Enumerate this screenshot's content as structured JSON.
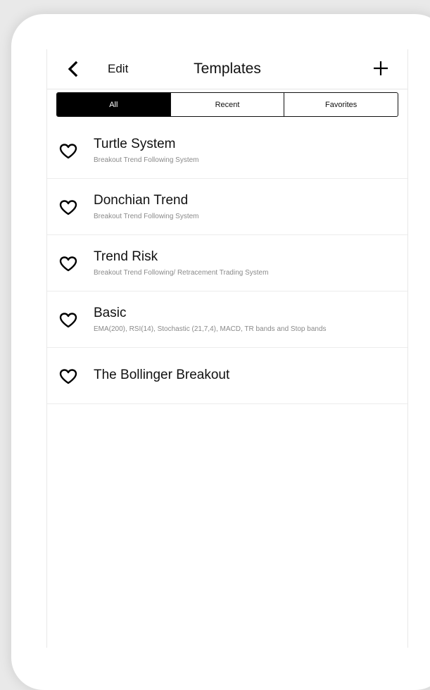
{
  "navbar": {
    "back_icon": "chevron-left-icon",
    "edit_label": "Edit",
    "title": "Templates",
    "add_icon": "plus-icon"
  },
  "tabs": [
    {
      "label": "All",
      "active": true
    },
    {
      "label": "Recent",
      "active": false
    },
    {
      "label": "Favorites",
      "active": false
    }
  ],
  "templates": [
    {
      "title": "Turtle System",
      "subtitle": "Breakout Trend Following System",
      "favorite_icon": "heart-outline-icon"
    },
    {
      "title": "Donchian Trend",
      "subtitle": "Breakout Trend Following System",
      "favorite_icon": "heart-outline-icon"
    },
    {
      "title": "Trend Risk",
      "subtitle": "Breakout Trend Following/ Retracement Trading System",
      "favorite_icon": "heart-outline-icon"
    },
    {
      "title": "Basic",
      "subtitle": "EMA(200), RSI(14), Stochastic (21,7,4), MACD, TR bands and Stop bands",
      "favorite_icon": "heart-outline-icon"
    },
    {
      "title": "The Bollinger Breakout",
      "subtitle": "",
      "favorite_icon": "heart-outline-icon"
    }
  ],
  "colors": {
    "active_tab_bg": "#000000",
    "active_tab_text": "#ffffff",
    "subtitle": "#8a8a8a"
  }
}
